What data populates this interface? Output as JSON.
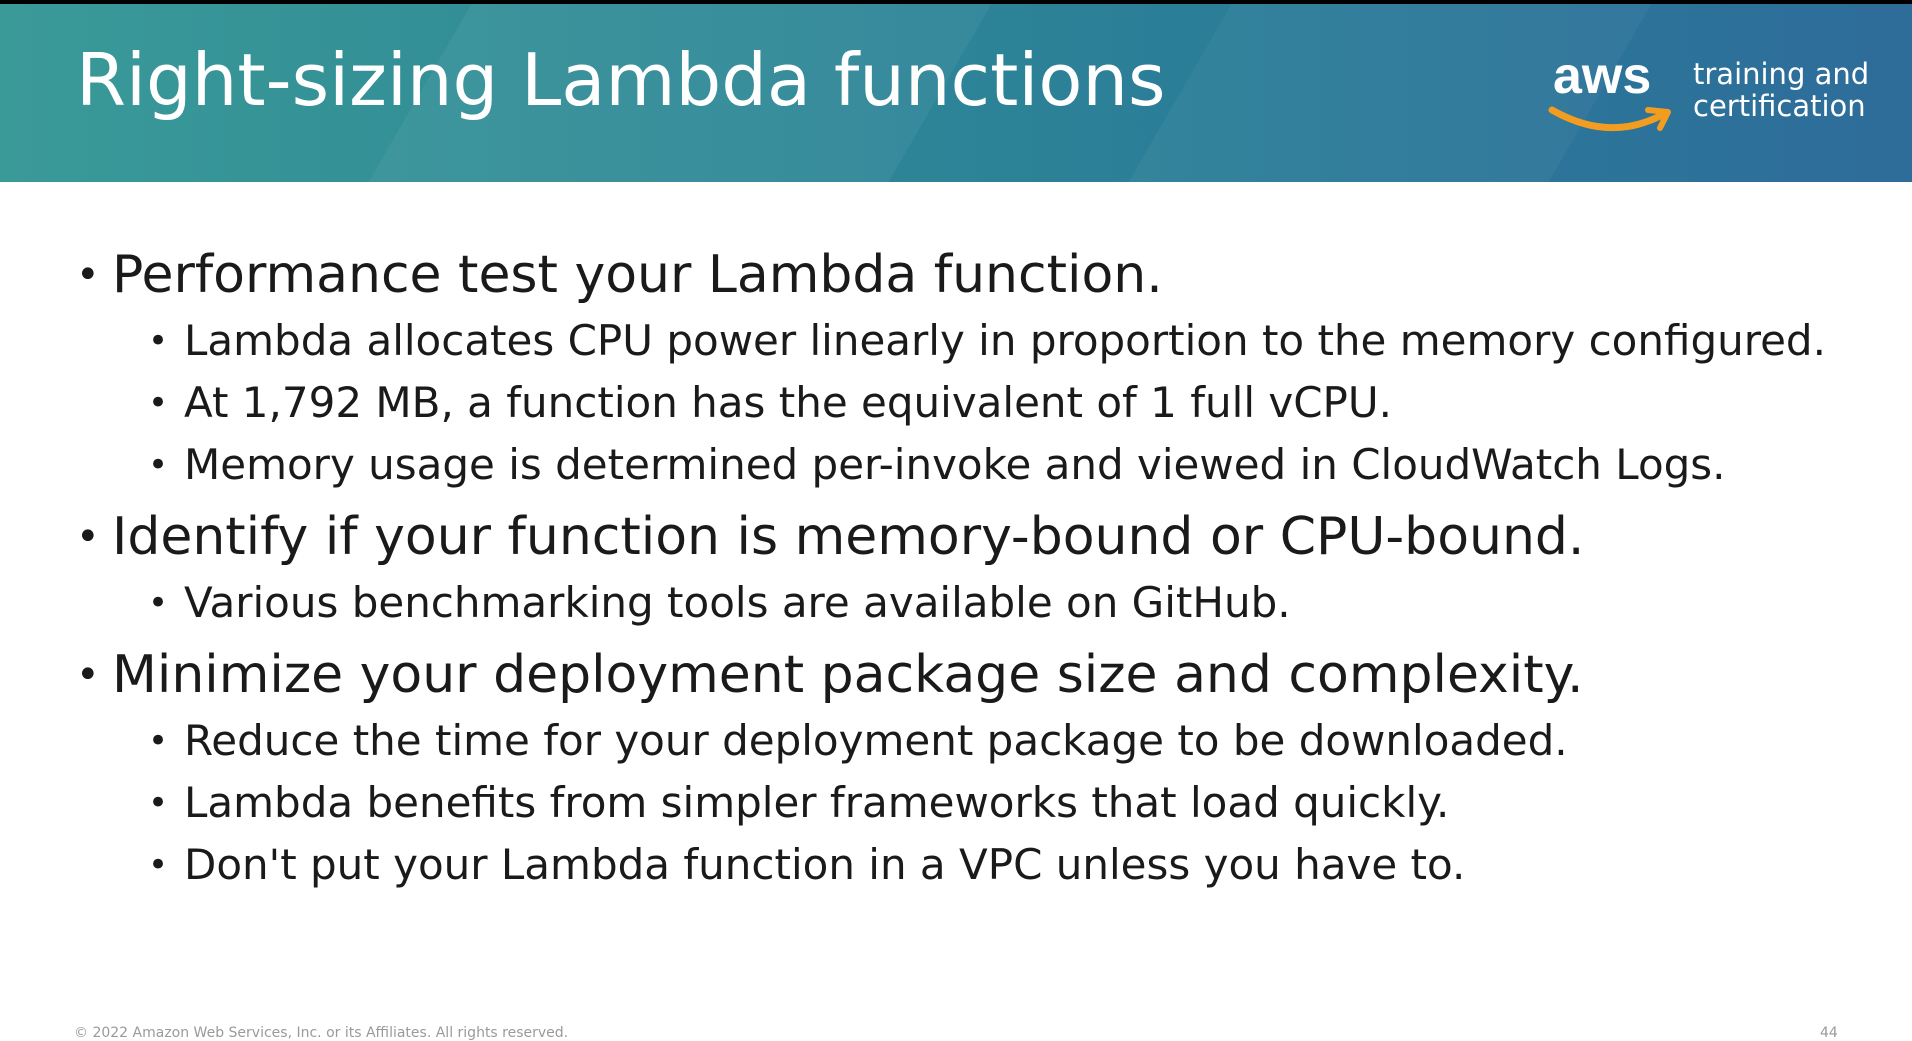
{
  "header": {
    "title": "Right-sizing Lambda functions",
    "logo": {
      "wordmark": "aws",
      "tagline_line1": "training and",
      "tagline_line2": "certification",
      "smile_color": "#f29d1f"
    },
    "colors": {
      "gradient_start": "#3a9a98",
      "gradient_end": "#2e6c9a"
    }
  },
  "bullets": [
    {
      "text": "Performance test your Lambda function.",
      "sub": [
        "Lambda allocates CPU power linearly in proportion to the memory configured.",
        "At 1,792 MB, a function has the equivalent of 1 full vCPU.",
        "Memory usage is determined per-invoke and viewed in CloudWatch Logs."
      ]
    },
    {
      "text": "Identify if your function is memory-bound or CPU-bound.",
      "sub": [
        "Various benchmarking tools are available on GitHub."
      ]
    },
    {
      "text": "Minimize your deployment package size and complexity.",
      "sub": [
        "Reduce the time for your deployment package to be downloaded.",
        "Lambda benefits from simpler frameworks that load quickly.",
        "Don't put your Lambda function in a VPC unless you have to."
      ]
    }
  ],
  "footer": {
    "copyright": "© 2022 Amazon Web Services, Inc. or its Affiliates. All rights reserved.",
    "page_number": "44"
  }
}
